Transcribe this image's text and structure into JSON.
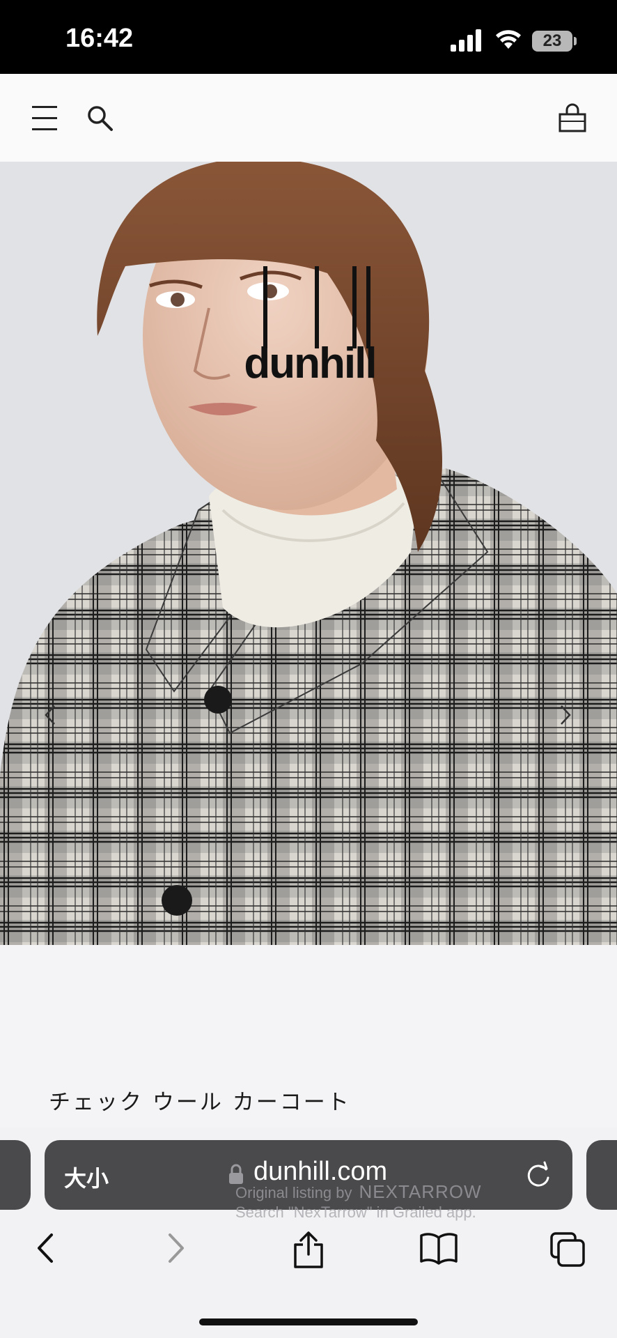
{
  "status_bar": {
    "time": "16:42",
    "battery": "23",
    "icons": [
      "signal-icon",
      "wifi-icon",
      "battery-icon"
    ]
  },
  "header": {
    "logo_text": "dunhill",
    "icons": [
      "menu-icon",
      "search-icon",
      "bag-icon"
    ]
  },
  "hero": {
    "icons": [
      "chevron-left-icon",
      "chevron-right-icon"
    ],
    "colors": {
      "backdrop": "#e0e1e4",
      "coat_dark": "#2a2a2a",
      "coat_light": "#e8e6e2",
      "sweater": "#efece4",
      "hair": "#7a4a30"
    }
  },
  "product": {
    "title": "チェック ウール カーコート"
  },
  "safari": {
    "text_size_label": "大小",
    "url": "dunhill.com",
    "watermark_line1": "Original listing by",
    "watermark_brand": "NEXTARROW",
    "watermark_line2": "Search \"NexTarrow\" in Grailed app.",
    "toolbar_icons": [
      "back-icon",
      "forward-icon",
      "share-icon",
      "bookmarks-icon",
      "tabs-icon"
    ]
  }
}
